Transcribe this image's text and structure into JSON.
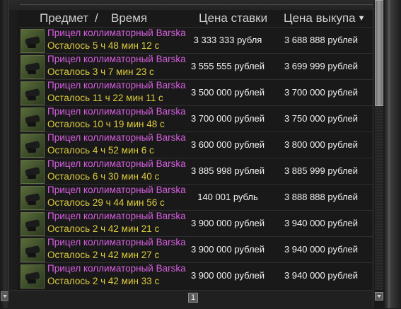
{
  "header": {
    "item_label": "Предмет",
    "separator": "/",
    "time_label": "Время",
    "bid_label": "Цена ставки",
    "buyout_label": "Цена выкупа",
    "sort_icon": "▼"
  },
  "rows": [
    {
      "name": "Прицел коллиматорный Barska",
      "timer": "Осталось 5 ч 48 мин 12 с",
      "bid": "3 333 333 рубля",
      "buyout": "3 688 888 рублей"
    },
    {
      "name": "Прицел коллиматорный Barska",
      "timer": "Осталось 3 ч 7 мин 23 с",
      "bid": "3 555 555 рублей",
      "buyout": "3 699 999 рублей"
    },
    {
      "name": "Прицел коллиматорный Barska",
      "timer": "Осталось 11 ч 22 мин 11 с",
      "bid": "3 500 000 рублей",
      "buyout": "3 700 000 рублей"
    },
    {
      "name": "Прицел коллиматорный Barska",
      "timer": "Осталось 10 ч 19 мин 48 с",
      "bid": "3 700 000 рублей",
      "buyout": "3 750 000 рублей"
    },
    {
      "name": "Прицел коллиматорный Barska",
      "timer": "Осталось 4 ч 52 мин 6 с",
      "bid": "3 600 000 рублей",
      "buyout": "3 800 000 рублей"
    },
    {
      "name": "Прицел коллиматорный Barska",
      "timer": "Осталось 6 ч 30 мин 40 с",
      "bid": "3 885 998 рублей",
      "buyout": "3 885 999 рублей"
    },
    {
      "name": "Прицел коллиматорный Barska",
      "timer": "Осталось 29 ч 44 мин 56 с",
      "bid": "140 001 рубль",
      "buyout": "3 888 888 рублей"
    },
    {
      "name": "Прицел коллиматорный Barska",
      "timer": "Осталось 2 ч 42 мин 21 с",
      "bid": "3 900 000 рублей",
      "buyout": "3 940 000 рублей"
    },
    {
      "name": "Прицел коллиматорный Barska",
      "timer": "Осталось 2 ч 42 мин 27 с",
      "bid": "3 900 000 рублей",
      "buyout": "3 940 000 рублей"
    },
    {
      "name": "Прицел коллиматорный Barska",
      "timer": "Осталось 2 ч 42 мин 33 с",
      "bid": "3 900 000 рублей",
      "buyout": "3 940 000 рублей"
    }
  ],
  "pagination": {
    "current_page": "1"
  },
  "icons": {
    "item_thumb": "scope-icon",
    "scroll_down": "chevron-down-icon"
  },
  "colors": {
    "item_name": "#d65ee0",
    "timer": "#dccb3c",
    "price": "#f2f2f2",
    "header": "#cfcfcf"
  }
}
